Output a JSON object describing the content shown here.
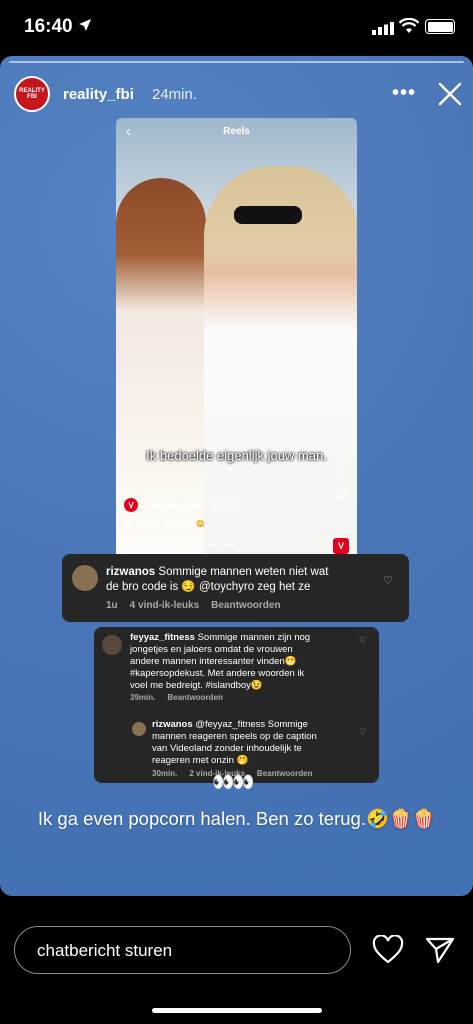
{
  "status": {
    "time": "16:40"
  },
  "story": {
    "account_avatar_label": "REALITY FBI",
    "username": "reality_fbi",
    "time_ago": "24min.",
    "more_label": "•••"
  },
  "reel": {
    "title": "Reels",
    "subtitle": "Ik bedoelde eigenlijk jouw man.",
    "likes": "258",
    "comments": "10",
    "account": "videolandonline",
    "follow_label": "Volgen",
    "caption": "Als dit maar goed gaat 😳 ...",
    "audio": "landonline · Origine",
    "people": "14 personen",
    "logo_letter": "V"
  },
  "comments": [
    {
      "user": "rizwanos",
      "text": "Sommige mannen weten niet wat de bro code is 😏 @toychyro zeg het ze",
      "line1": "Sommige mannen weten niet wat",
      "line2": "de bro code is 😏 @toychyro zeg het ze",
      "time": "1u",
      "likes": "4 vind-ik-leuks",
      "reply": "Beantwoorden"
    },
    {
      "user": "feyyaz_fitness",
      "line1": "Sommige mannen zijn nog",
      "line2": "jongetjes en jaloers omdat de vrouwen",
      "line3": "andere mannen interessanter vinden😁",
      "line4": "#kapersopdekust. Met andere woorden ik",
      "line5": "voel me bedreigt. #islandboy😉",
      "time": "39min.",
      "reply": "Beantwoorden"
    },
    {
      "user": "rizwanos",
      "line1": "@feyyaz_fitness Sommige",
      "line2": "mannen reageren speels op de caption",
      "line3": "van Videoland zonder inhoudelijk te",
      "line4": "reageren met onzin 🤭",
      "time": "30min.",
      "likes": "2 vind-ik-leuks",
      "reply": "Beantwoorden"
    }
  ],
  "overlay": {
    "eyes": "👀👀",
    "text": "Ik ga even popcorn halen. Ben zo terug.🤣🍿🍿"
  },
  "bottom": {
    "reply_placeholder": "chatbericht sturen"
  }
}
